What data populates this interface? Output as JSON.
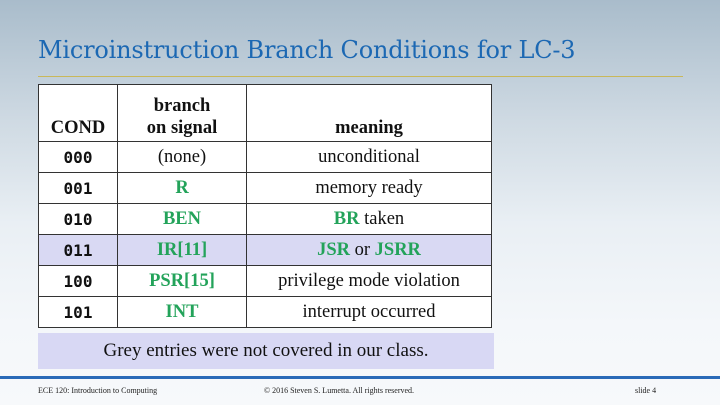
{
  "slide": {
    "title": "Microinstruction Branch Conditions for LC-3",
    "note": "Grey entries were not covered in our class.",
    "footer_left": "ECE 120: Introduction to Computing",
    "footer_center": "© 2016 Steven S. Lumetta.  All rights reserved.",
    "footer_right": "slide 4"
  },
  "table": {
    "headers": {
      "cond": "COND",
      "signal_line1": "branch",
      "signal_line2": "on signal",
      "meaning": "meaning"
    },
    "rows": [
      {
        "cond": "000",
        "signal": "(none)",
        "meaning": "unconditional"
      },
      {
        "cond": "001",
        "signal": "R",
        "meaning": "memory ready"
      },
      {
        "cond": "010",
        "signal": "BEN",
        "meaning_part1": "BR",
        "meaning_part2": " taken"
      },
      {
        "cond": "011",
        "signal": "IR[11]",
        "meaning_part1": "JSR",
        "meaning_part2": " or ",
        "meaning_part3": "JSRR"
      },
      {
        "cond": "100",
        "signal": "PSR[15]",
        "meaning": "privilege mode violation"
      },
      {
        "cond": "101",
        "signal": "INT",
        "meaning": "interrupt occurred"
      }
    ]
  },
  "colors": {
    "title": "#1c68b3",
    "signal_green": "#23a35a",
    "grey_row": "#d9d9f3",
    "footer_rule": "#2a6ab8"
  }
}
